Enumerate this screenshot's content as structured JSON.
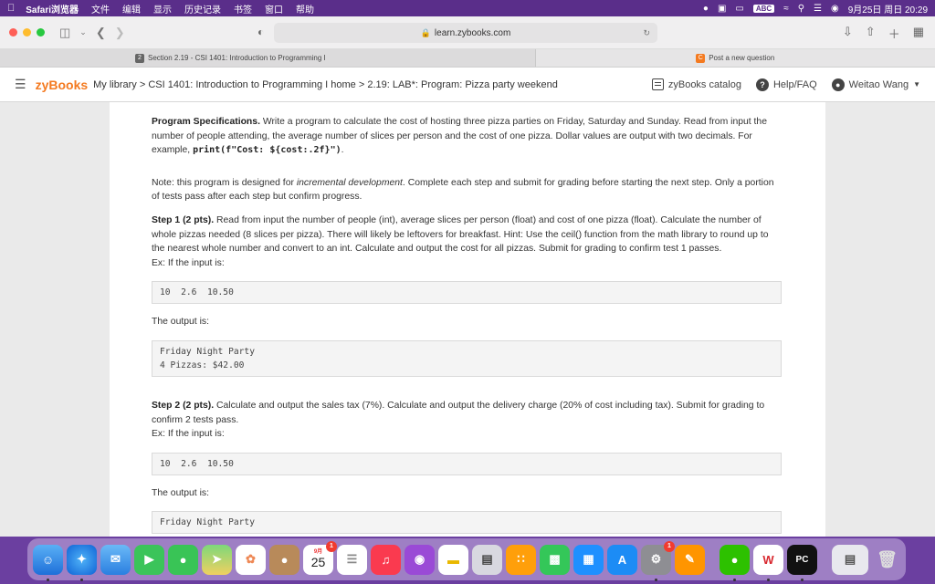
{
  "menubar": {
    "app_name": "Safari浏览器",
    "items": [
      "文件",
      "编辑",
      "显示",
      "历史记录",
      "书签",
      "窗口",
      "帮助"
    ],
    "input_badge": "ABC",
    "datetime": "9月25日 周日 20:29"
  },
  "safari": {
    "url": "learn.zybooks.com",
    "tabs": [
      {
        "label": "Section 2.19 - CSI 1401: Introduction to Programming I",
        "favicon": "2"
      },
      {
        "label": "Post a new question",
        "favicon": "C"
      }
    ]
  },
  "zybooks": {
    "logo": "zyBooks",
    "breadcrumb": "My library > CSI 1401: Introduction to Programming I home > 2.19: LAB*: Program: Pizza party weekend",
    "catalog_label": "zyBooks catalog",
    "help_label": "Help/FAQ",
    "user_name": "Weitao Wang"
  },
  "content": {
    "spec_title": "Program Specifications.",
    "spec_text": " Write a program to calculate the cost of hosting three pizza parties on Friday, Saturday and Sunday. Read from input the number of people attending, the average number of slices per person and the cost of one pizza. Dollar values are output with two decimals. For example, ",
    "spec_code": "print(f\"Cost: ${cost:.2f}\")",
    "spec_end": ".",
    "note_pre": "Note: this program is designed for ",
    "note_em": "incremental development",
    "note_post": ". Complete each step and submit for grading before starting the next step. Only a portion of tests pass after each step but confirm progress.",
    "step1_title": "Step 1 (2 pts).",
    "step1_text": " Read from input the number of people (int), average slices per person (float) and cost of one pizza (float). Calculate the number of whole pizzas needed (8 slices per pizza). There will likely be leftovers for breakfast. Hint: Use the ceil() function from the math library to round up to the nearest whole number and convert to an int. Calculate and output the cost for all pizzas. Submit for grading to confirm test 1 passes.",
    "ex_input_label": "Ex: If the input is:",
    "ex1_input": "10  2.6  10.50",
    "output_label": "The output is:",
    "ex1_output": "Friday Night Party\n4 Pizzas: $42.00",
    "step2_title": "Step 2 (2 pts).",
    "step2_text": " Calculate and output the sales tax (7%). Calculate and output the delivery charge (20% of cost including tax). Submit for grading to confirm 2 tests pass.",
    "ex2_input": "10  2.6  10.50",
    "ex2_output": "Friday Night Party"
  },
  "dock": {
    "calendar_month": "9月",
    "calendar_day": "25",
    "calendar_badge": "1",
    "settings_badge": "1",
    "pycharm_label": "PC"
  }
}
